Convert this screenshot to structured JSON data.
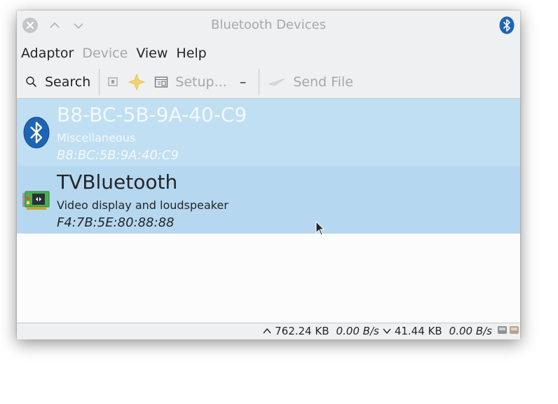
{
  "window": {
    "title": "Bluetooth Devices"
  },
  "menu": {
    "items": [
      {
        "label": "Adaptor",
        "enabled": true
      },
      {
        "label": "Device",
        "enabled": false
      },
      {
        "label": "View",
        "enabled": true
      },
      {
        "label": "Help",
        "enabled": true
      }
    ]
  },
  "toolbar": {
    "search_label": "Search",
    "setup_label": "Setup...",
    "send_file_label": "Send File",
    "remove_label": "–"
  },
  "devices": [
    {
      "name": "B8-BC-5B-9A-40-C9",
      "type": "Miscellaneous",
      "address": "B8:BC:5B:9A:40:C9",
      "icon": "bluetooth-icon"
    },
    {
      "name": "TVBluetooth",
      "type": "Video display and loudspeaker",
      "address": "F4:7B:5E:80:88:88",
      "icon": "video-card-icon"
    }
  ],
  "status": {
    "upload_total": "762.24 KB",
    "upload_rate": "0.00 B/s",
    "download_total": "41.44 KB",
    "download_rate": "0.00 B/s"
  },
  "colors": {
    "selection_first": "#c0dff3",
    "selection_second": "#b5d8f0",
    "bluetooth_blue": "#1d64b4"
  }
}
